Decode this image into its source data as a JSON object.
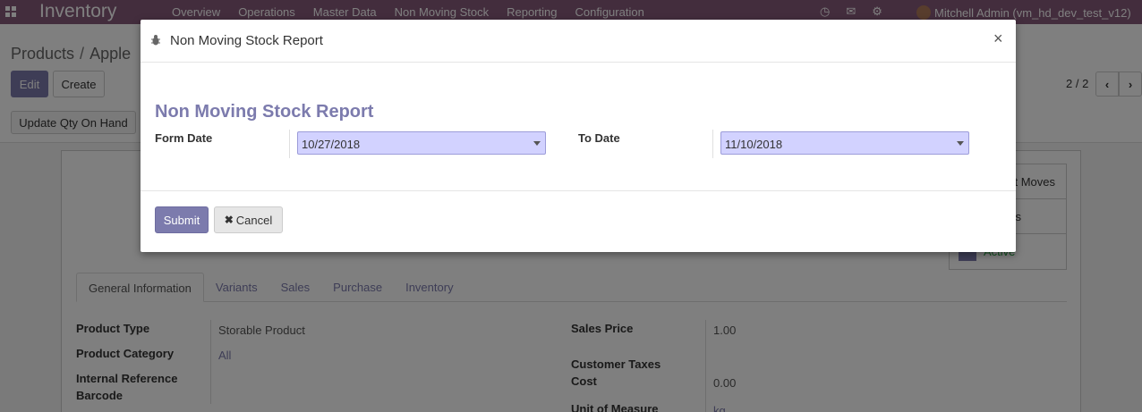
{
  "topbar": {
    "brand": "Inventory",
    "menu": [
      "Overview",
      "Operations",
      "Master Data",
      "Non Moving Stock",
      "Reporting",
      "Configuration"
    ],
    "icons": [
      "clock-icon",
      "chat-icon",
      "bug-icon"
    ],
    "user": "Mitchell Admin (vm_hd_dev_test_v12)"
  },
  "control_panel": {
    "breadcrumb": [
      "Products",
      "Apple"
    ],
    "breadcrumb_sep": "/",
    "edit_label": "Edit",
    "create_label": "Create",
    "pager": "2 / 2",
    "update_qty_label": "Update Qty On Hand"
  },
  "smart_buttons": {
    "moves": "ct Moves",
    "second": "s",
    "active": "Active"
  },
  "tabs": [
    "General Information",
    "Variants",
    "Sales",
    "Purchase",
    "Inventory"
  ],
  "product_fields": {
    "product_type_label": "Product Type",
    "product_type_value": "Storable Product",
    "product_category_label": "Product Category",
    "product_category_value": "All",
    "internal_ref_label": "Internal Reference",
    "barcode_label": "Barcode",
    "sales_price_label": "Sales Price",
    "sales_price_value": "1.00",
    "customer_taxes_label": "Customer Taxes",
    "cost_label": "Cost",
    "cost_value": "0.00",
    "uom_label": "Unit of Measure",
    "uom_value": "kg"
  },
  "modal": {
    "title": "Non Moving Stock Report",
    "heading": "Non Moving Stock Report",
    "from_label": "Form Date",
    "from_value": "10/27/2018",
    "to_label": "To Date",
    "to_value": "11/10/2018",
    "submit_label": "Submit",
    "cancel_label": "Cancel",
    "close_symbol": "×"
  }
}
